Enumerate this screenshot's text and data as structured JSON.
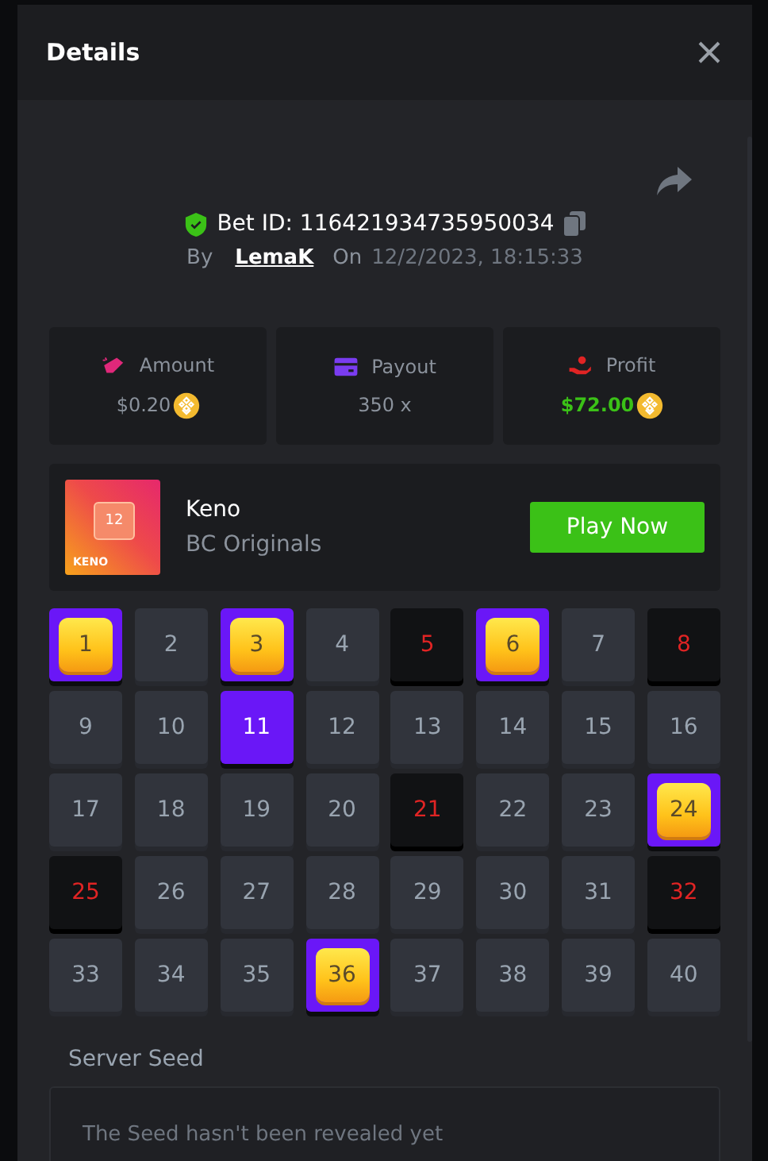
{
  "dialog": {
    "title": "Details"
  },
  "bet": {
    "id_label": "Bet ID: 116421934735950034",
    "by_label": "By",
    "user": "LemaK",
    "on_label": "On",
    "date": "12/2/2023, 18:15:33"
  },
  "stats": [
    {
      "kind": "amount",
      "label": "Amount",
      "value": "$0.20",
      "coin": true,
      "positive": false
    },
    {
      "kind": "payout",
      "label": "Payout",
      "value": "350 x",
      "coin": false,
      "positive": false
    },
    {
      "kind": "profit",
      "label": "Profit",
      "value": "$72.00",
      "coin": true,
      "positive": true
    }
  ],
  "game": {
    "thumb_number": "12",
    "thumb_label": "KENO",
    "name": "Keno",
    "provider": "BC Originals",
    "button": "Play Now"
  },
  "cells": [
    {
      "n": "1",
      "selected": true,
      "drawn": true
    },
    {
      "n": "2",
      "selected": false,
      "drawn": false
    },
    {
      "n": "3",
      "selected": true,
      "drawn": true
    },
    {
      "n": "4",
      "selected": false,
      "drawn": false
    },
    {
      "n": "5",
      "selected": false,
      "drawn": true
    },
    {
      "n": "6",
      "selected": true,
      "drawn": true
    },
    {
      "n": "7",
      "selected": false,
      "drawn": false
    },
    {
      "n": "8",
      "selected": false,
      "drawn": true
    },
    {
      "n": "9",
      "selected": false,
      "drawn": false
    },
    {
      "n": "10",
      "selected": false,
      "drawn": false
    },
    {
      "n": "11",
      "selected": true,
      "drawn": false
    },
    {
      "n": "12",
      "selected": false,
      "drawn": false
    },
    {
      "n": "13",
      "selected": false,
      "drawn": false
    },
    {
      "n": "14",
      "selected": false,
      "drawn": false
    },
    {
      "n": "15",
      "selected": false,
      "drawn": false
    },
    {
      "n": "16",
      "selected": false,
      "drawn": false
    },
    {
      "n": "17",
      "selected": false,
      "drawn": false
    },
    {
      "n": "18",
      "selected": false,
      "drawn": false
    },
    {
      "n": "19",
      "selected": false,
      "drawn": false
    },
    {
      "n": "20",
      "selected": false,
      "drawn": false
    },
    {
      "n": "21",
      "selected": false,
      "drawn": true
    },
    {
      "n": "22",
      "selected": false,
      "drawn": false
    },
    {
      "n": "23",
      "selected": false,
      "drawn": false
    },
    {
      "n": "24",
      "selected": true,
      "drawn": true
    },
    {
      "n": "25",
      "selected": false,
      "drawn": true
    },
    {
      "n": "26",
      "selected": false,
      "drawn": false
    },
    {
      "n": "27",
      "selected": false,
      "drawn": false
    },
    {
      "n": "28",
      "selected": false,
      "drawn": false
    },
    {
      "n": "29",
      "selected": false,
      "drawn": false
    },
    {
      "n": "30",
      "selected": false,
      "drawn": false
    },
    {
      "n": "31",
      "selected": false,
      "drawn": false
    },
    {
      "n": "32",
      "selected": false,
      "drawn": true
    },
    {
      "n": "33",
      "selected": false,
      "drawn": false
    },
    {
      "n": "34",
      "selected": false,
      "drawn": false
    },
    {
      "n": "35",
      "selected": false,
      "drawn": false
    },
    {
      "n": "36",
      "selected": true,
      "drawn": true
    },
    {
      "n": "37",
      "selected": false,
      "drawn": false
    },
    {
      "n": "38",
      "selected": false,
      "drawn": false
    },
    {
      "n": "39",
      "selected": false,
      "drawn": false
    },
    {
      "n": "40",
      "selected": false,
      "drawn": false
    }
  ],
  "server_seed": {
    "label": "Server Seed",
    "text": "The Seed hasn't been revealed yet"
  }
}
